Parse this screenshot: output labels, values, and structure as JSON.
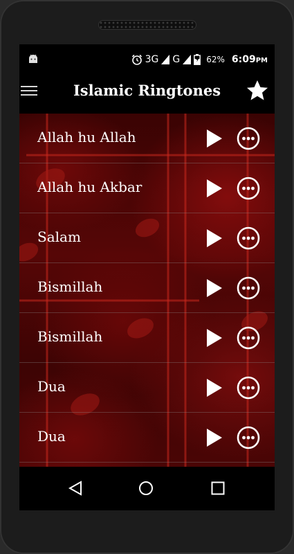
{
  "status": {
    "network": "3G",
    "carrier": "G",
    "battery": "62%",
    "time": "6:09",
    "ampm": "PM",
    "icons": [
      "android-icon",
      "alarm-icon",
      "signal-icon",
      "battery-icon"
    ]
  },
  "appbar": {
    "title": "Islamic Ringtones",
    "menu_icon": "menu-icon",
    "favorite_icon": "star-icon"
  },
  "ringtones": [
    {
      "title": "Allah hu Allah"
    },
    {
      "title": "Allah hu Akbar"
    },
    {
      "title": "Salam"
    },
    {
      "title": "Bismillah"
    },
    {
      "title": "Bismillah"
    },
    {
      "title": "Dua"
    },
    {
      "title": "Dua"
    }
  ],
  "navbar": {
    "icons": [
      "back-icon",
      "home-icon",
      "recent-apps-icon"
    ]
  },
  "colors": {
    "background": "#000000",
    "list_tint": "#5a0606",
    "text": "#ffffff"
  }
}
